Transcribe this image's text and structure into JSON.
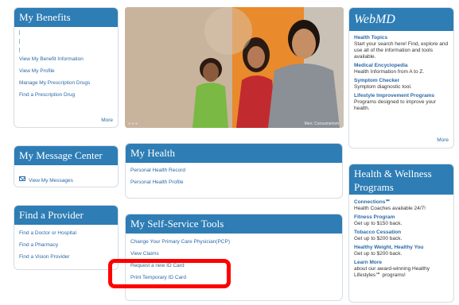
{
  "my_benefits": {
    "title": "My Benefits",
    "links": [
      "View My Benefit Information",
      "View My Profile",
      "Manage My Prescription Drugs",
      "Find a Prescription Drug"
    ],
    "more": "More"
  },
  "hero": {
    "credit": "Men: Consumerism"
  },
  "webmd": {
    "brand": "WebMD",
    "items": [
      {
        "title": "Health Topics",
        "desc": "Start your search here! Find, explore and use all of the information and tools available."
      },
      {
        "title": "Medical Encyclopedia",
        "desc": "Health Information from A to Z."
      },
      {
        "title": "Symptom Checker",
        "desc": "Symptom diagnostic tool."
      },
      {
        "title": "Lifestyle Improvement Programs",
        "desc": "Programs designed to improve your health."
      }
    ],
    "more": "More"
  },
  "message_center": {
    "title": "My Message Center",
    "link": "View My Messages"
  },
  "my_health": {
    "title": "My Health",
    "links": [
      "Personal Health Record",
      "Personal Health Profile"
    ]
  },
  "find_provider": {
    "title": "Find a Provider",
    "links": [
      "Find a Doctor or Hospital",
      "Find a Pharmacy",
      "Find a Vision Provider"
    ]
  },
  "self_service": {
    "title": "My Self-Service Tools",
    "links": [
      "Change Your Primary Care Physician(PCP)",
      "View Claims",
      "Request a new ID Card",
      "Print Temporary ID Card"
    ]
  },
  "wellness": {
    "title": "Health & Wellness Programs",
    "items": [
      {
        "title": "Connections℠",
        "desc": "Health Coaches available 24/7!"
      },
      {
        "title": "Fitness Program",
        "desc": "Get up to $150 back."
      },
      {
        "title": "Tobacco Cessation",
        "desc": "Get up to $200 back."
      },
      {
        "title": "Healthy Weight, Healthy You",
        "desc": "Get up to $200 back."
      },
      {
        "title": "Learn More",
        "desc": "about our award-winning Healthy Lifestyles℠ programs!"
      }
    ]
  },
  "colors": {
    "header_blue": "#2e7db5",
    "link_blue": "#2b6aa6",
    "highlight_red": "#ff0000"
  }
}
